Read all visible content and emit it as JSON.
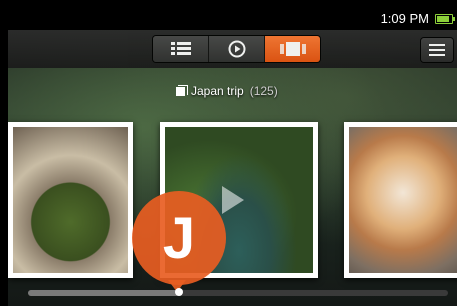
{
  "status_bar": {
    "time": "1:09 PM",
    "battery_color": "#8ccf3a"
  },
  "toolbar": {
    "views": [
      {
        "name": "grid-view",
        "icon": "grid-list-icon",
        "active": false
      },
      {
        "name": "slideshow",
        "icon": "play-circle-icon",
        "active": false
      },
      {
        "name": "filmstrip",
        "icon": "filmstrip-icon",
        "active": true
      }
    ],
    "menu_icon": "hamburger-menu-icon",
    "accent": "#e85410"
  },
  "album": {
    "title": "Japan trip",
    "count": "(125)"
  },
  "photos": [
    {
      "subject": "moss ball bonsai"
    },
    {
      "subject": "japanese garden with pond",
      "is_video": true
    },
    {
      "subject": "sleeping cat"
    }
  ],
  "scrub_bubble": {
    "letter": "J"
  },
  "scrubber": {
    "progress": 0.36
  }
}
